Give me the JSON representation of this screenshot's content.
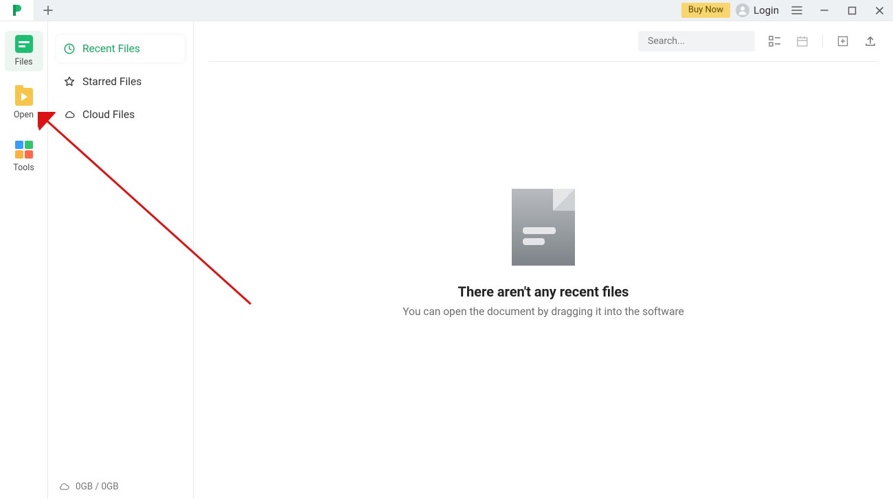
{
  "titlebar": {
    "buy_now": "Buy Now",
    "login": "Login"
  },
  "rail": {
    "items": [
      {
        "label": "Files"
      },
      {
        "label": "Open"
      },
      {
        "label": "Tools"
      }
    ]
  },
  "subnav": {
    "items": [
      {
        "label": "Recent Files"
      },
      {
        "label": "Starred Files"
      },
      {
        "label": "Cloud Files"
      }
    ]
  },
  "storage": {
    "text": "0GB / 0GB"
  },
  "search": {
    "placeholder": "Search..."
  },
  "empty": {
    "title": "There aren't any recent files",
    "subtitle": "You can open the document by dragging it into the software"
  }
}
